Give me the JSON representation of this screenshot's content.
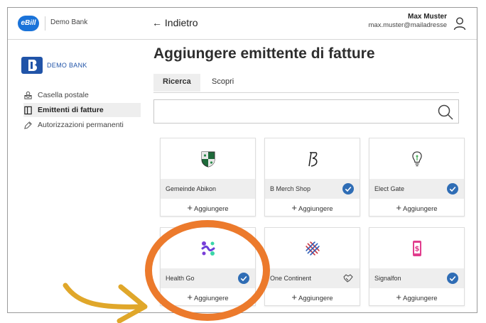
{
  "topbar": {
    "ebill_logo": "eBill",
    "bank_name": "Demo Bank",
    "back_label": "← Indietro",
    "user_name": "Max Muster",
    "user_email": "max.muster@mailadresse"
  },
  "sidebar": {
    "brand": "DEMO BANK",
    "items": [
      {
        "label": "Casella postale",
        "icon": "mailbox-icon"
      },
      {
        "label": "Emittenti di fatture",
        "icon": "invoice-issuer-icon",
        "active": true
      },
      {
        "label": "Autorizzazioni permanenti",
        "icon": "permission-tag-icon"
      }
    ]
  },
  "main": {
    "title": "Aggiungere emittente di fatture",
    "tabs": [
      {
        "label": "Ricerca",
        "active": true
      },
      {
        "label": "Scopri"
      }
    ],
    "search_placeholder": "",
    "add_label": "Aggiungere",
    "cards": [
      {
        "name": "Gemeinde Abikon",
        "logo": "municipal-shield-icon",
        "status": "none"
      },
      {
        "name": "B Merch Shop",
        "logo": "b-letter-logo-icon",
        "status": "added-check"
      },
      {
        "name": "Elect Gate",
        "logo": "lightbulb-icon",
        "status": "added-check"
      },
      {
        "name": "Health Go",
        "logo": "health-people-icon",
        "status": "added-check"
      },
      {
        "name": "One Continent",
        "logo": "striped-globe-icon",
        "status": "pending-handshake"
      },
      {
        "name": "Signalfon",
        "logo": "phone-dollar-icon",
        "status": "added-check"
      }
    ]
  },
  "colors": {
    "accent_blue": "#1a73d9",
    "check_blue": "#2f6db5",
    "highlight_circle": "#ec7a2c",
    "arrow": "#e0a72a"
  }
}
